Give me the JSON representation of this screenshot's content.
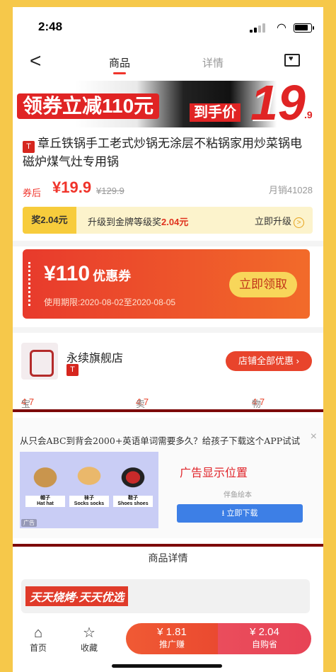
{
  "status": {
    "time": "2:48"
  },
  "nav": {
    "back": "<",
    "tabs": [
      {
        "label": "商品"
      },
      {
        "label": "详情"
      }
    ]
  },
  "banner": {
    "coupon_text": "领券立减110元",
    "final_label": "到手价",
    "price_int": "19",
    "price_dec": ".9"
  },
  "product": {
    "title": "章丘铁锅手工老式炒锅无涂层不粘锅家用炒菜锅电磁炉煤气灶专用锅",
    "tmall_badge": "T",
    "after_coupon_label": "券后",
    "price": "¥19.9",
    "original_price": "¥129.9",
    "monthly_sales": "月销41028"
  },
  "reward": {
    "tag": "奖2.04元",
    "text_prefix": "升级到金牌等级奖",
    "amount": "2.04元",
    "upgrade": "立即升级",
    "upgrade_icon": ">"
  },
  "coupon": {
    "amount": "¥110",
    "label": "优惠券",
    "period": "使用期限:2020-08-02至2020-08-05",
    "claim": "立即领取"
  },
  "store": {
    "name": "永续旗舰店",
    "all_offers": "店铺全部优惠 ›",
    "scores": [
      {
        "label": "宝贝描述",
        "value": "4.7"
      },
      {
        "label": "卖家服务",
        "value": "4.7"
      },
      {
        "label": "物流服务",
        "value": "4.7"
      }
    ]
  },
  "ad": {
    "title": "从只会ABC到背会2000+英语单词需要多久？给孩子下载这个APP试试",
    "close": "×",
    "placeholder": "广告显示位置",
    "brand": "伴鱼绘本",
    "download": "立即下载",
    "items": [
      {
        "cn": "帽子",
        "en": "Hat hat"
      },
      {
        "cn": "袜子",
        "en": "Socks socks"
      },
      {
        "cn": "鞋子",
        "en": "Shoes shoes"
      }
    ],
    "ad_tag": "广告"
  },
  "detail": {
    "heading": "商品详情"
  },
  "promo": {
    "text": "天天烧烤·天天优选"
  },
  "bottom": {
    "home": "首页",
    "collect": "收藏",
    "promote_value": "¥ 1.81",
    "promote_label": "推广赚",
    "self_value": "¥ 2.04",
    "self_label": "自购省"
  }
}
